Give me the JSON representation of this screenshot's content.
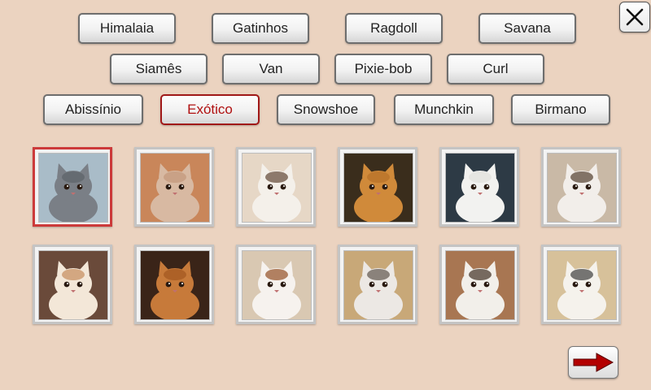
{
  "categories": [
    {
      "label": "Himalaia"
    },
    {
      "label": "Gatinhos"
    },
    {
      "label": "Ragdoll"
    },
    {
      "label": "Savana"
    },
    {
      "label": "Siamês"
    },
    {
      "label": "Van"
    },
    {
      "label": "Pixie-bob"
    },
    {
      "label": "Curl"
    },
    {
      "label": "Abissínio"
    },
    {
      "label": "Exótico",
      "selected": true
    },
    {
      "label": "Snowshoe"
    },
    {
      "label": "Munchkin"
    },
    {
      "label": "Birmano"
    }
  ],
  "photos": [
    {
      "bg": "#a9bcc8",
      "cat": "#7a7f86",
      "accent": "#5f6469",
      "selected": true
    },
    {
      "bg": "#c9865a",
      "cat": "#d8b9a2",
      "accent": "#c49a7c"
    },
    {
      "bg": "#e6d7c6",
      "cat": "#f4f0ea",
      "accent": "#6b5240"
    },
    {
      "bg": "#3a2d1c",
      "cat": "#d08a3a",
      "accent": "#b8712a"
    },
    {
      "bg": "#2d3a45",
      "cat": "#f2f2f0",
      "accent": "#e2e2de"
    },
    {
      "bg": "#c9b9a6",
      "cat": "#f2eeea",
      "accent": "#5c4a3a"
    },
    {
      "bg": "#6a4a3a",
      "cat": "#f3e7d8",
      "accent": "#c89264"
    },
    {
      "bg": "#3a2418",
      "cat": "#c77a3a",
      "accent": "#a45a22"
    },
    {
      "bg": "#d9c8b2",
      "cat": "#f6f2ee",
      "accent": "#9a5a32"
    },
    {
      "bg": "#c8a878",
      "cat": "#ece8e4",
      "accent": "#6a6058"
    },
    {
      "bg": "#a87652",
      "cat": "#f2efea",
      "accent": "#4c3c30"
    },
    {
      "bg": "#d7c19a",
      "cat": "#f5f2ec",
      "accent": "#4a4a4a"
    }
  ],
  "colors": {
    "background": "#ebd3c0",
    "selected_border": "#a01818",
    "selected_text": "#b01010",
    "arrow": "#b30000"
  },
  "icons": {
    "close": "close-icon",
    "next": "arrow-right-icon"
  }
}
